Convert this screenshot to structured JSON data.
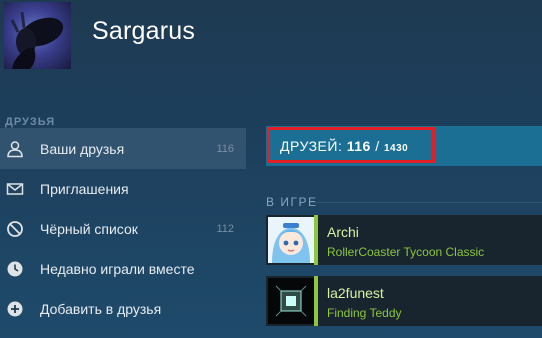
{
  "profile": {
    "name": "Sargarus"
  },
  "sidebar": {
    "section_label": "ДРУЗЬЯ",
    "items": [
      {
        "label": "Ваши друзья",
        "count": "116",
        "icon": "person-icon"
      },
      {
        "label": "Приглашения",
        "count": "",
        "icon": "envelope-icon"
      },
      {
        "label": "Чёрный список",
        "count": "112",
        "icon": "block-icon"
      },
      {
        "label": "Недавно играли вместе",
        "count": "",
        "icon": "clock-icon"
      },
      {
        "label": "Добавить в друзья",
        "count": "",
        "icon": "plus-circle-icon"
      }
    ]
  },
  "main": {
    "friend_count": {
      "prefix": "ДРУЗЕЙ:",
      "current": "116",
      "separator": "/",
      "total": "1430"
    },
    "ingame_label": "В ИГРЕ",
    "friends": [
      {
        "name": "Archi",
        "game": "RollerCoaster Tycoon Classic"
      },
      {
        "name": "la2funest",
        "game": "Finding Teddy"
      }
    ]
  },
  "colors": {
    "highlight_border": "#e51e25",
    "ingame_green": "#8dc63f",
    "banner_blue": "#1b6f95"
  }
}
